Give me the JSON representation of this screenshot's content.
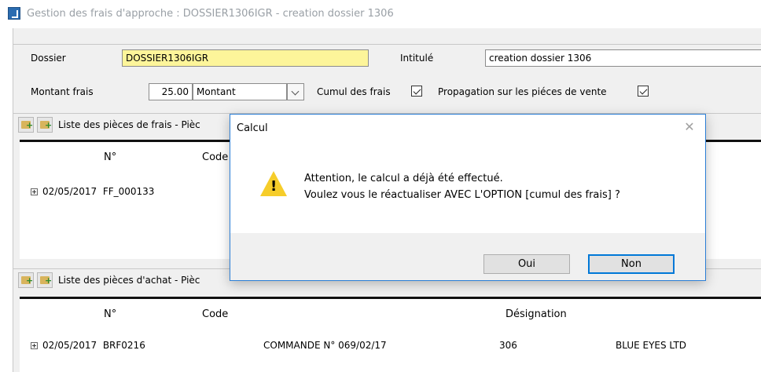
{
  "window": {
    "title": "Gestion des frais d'approche : DOSSIER1306IGR - creation dossier 1306"
  },
  "header": {
    "dossier_label": "Dossier",
    "dossier_value": "DOSSIER1306IGR",
    "intitule_label": "Intitulé",
    "intitule_value": "creation dossier 1306",
    "montant_frais_label": "Montant frais",
    "montant_frais_value": "25.00",
    "montant_type_value": "Montant",
    "cumul_label": "Cumul des frais",
    "cumul_checked": true,
    "propagation_label": "Propagation sur les piéces de vente",
    "propagation_checked": true
  },
  "frais_section": {
    "label": "Liste des pièces de frais - Pièc",
    "columns": [
      "N°",
      "Code"
    ],
    "rows": [
      {
        "date": "02/05/2017",
        "numero": "FF_000133"
      }
    ]
  },
  "achat_section": {
    "label": "Liste des pièces d'achat - Pièc",
    "columns": [
      "N°",
      "Code",
      "Désignation"
    ],
    "rows": [
      {
        "date": "02/05/2017",
        "numero": "BRF0216",
        "code": "COMMANDE N° 069/02/17",
        "designation": "306",
        "tiers": "BLUE EYES LTD"
      }
    ]
  },
  "dialog": {
    "title": "Calcul",
    "message_line1": "Attention, le calcul a déjà été effectué.",
    "message_line2": "Voulez vous le réactualiser AVEC  L'OPTION [cumul des frais] ?",
    "icon": "warning-icon",
    "buttons": {
      "yes": "Oui",
      "no": "Non"
    }
  },
  "colors": {
    "highlight_field": "#fdf59a",
    "dialog_border": "#2c7fd6",
    "default_button_border": "#0078d7",
    "warning": "#f6cd2a"
  }
}
